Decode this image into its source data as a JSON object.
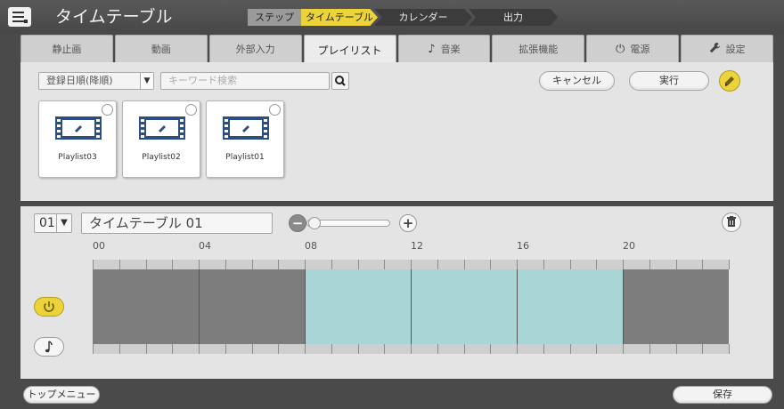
{
  "header": {
    "title": "タイムテーブル",
    "steps": {
      "label": "ステップ",
      "items": [
        "タイムテーブル",
        "カレンダー",
        "出力"
      ],
      "active": "タイムテーブル"
    }
  },
  "tabs": [
    {
      "label": "静止画",
      "icon": ""
    },
    {
      "label": "動画",
      "icon": ""
    },
    {
      "label": "外部入力",
      "icon": ""
    },
    {
      "label": "プレイリスト",
      "icon": ""
    },
    {
      "label": "音楽",
      "icon": "♪"
    },
    {
      "label": "拡張機能",
      "icon": ""
    },
    {
      "label": "電源",
      "icon": "⏻"
    },
    {
      "label": "設定",
      "icon": "🔧"
    }
  ],
  "active_tab": "プレイリスト",
  "filter": {
    "sort": "登録日順(降順)",
    "search_placeholder": "キーワード検索"
  },
  "actions": {
    "cancel": "キャンセル",
    "execute": "実行"
  },
  "playlists": [
    {
      "name": "Playlist03"
    },
    {
      "name": "Playlist02"
    },
    {
      "name": "Playlist01"
    }
  ],
  "timetable": {
    "number": "01",
    "name": "タイムテーブル 01",
    "hours": [
      "00",
      "04",
      "08",
      "12",
      "16",
      "20"
    ],
    "range_start_hour": 8,
    "range_end_hour": 20,
    "total_hours": 24,
    "colors": {
      "range": "#a8d6d6",
      "off": "#7d7d7d",
      "accent": "#ecd33a"
    }
  },
  "footer": {
    "top_menu": "トップメニュー",
    "save": "保存"
  }
}
